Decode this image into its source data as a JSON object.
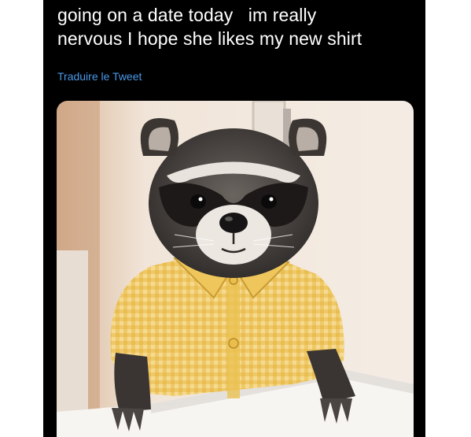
{
  "tweet": {
    "text_lines": [
      "going on a date today   im really",
      "nervous I hope she likes my new shirt"
    ],
    "translate_label": "Traduire le Tweet"
  },
  "media": {
    "subject": "raccoon wearing a yellow gingham shirt",
    "colors": {
      "background": "#000000",
      "text": "#ffffff",
      "link": "#4a99e9",
      "shirt": "#e7b846"
    }
  }
}
